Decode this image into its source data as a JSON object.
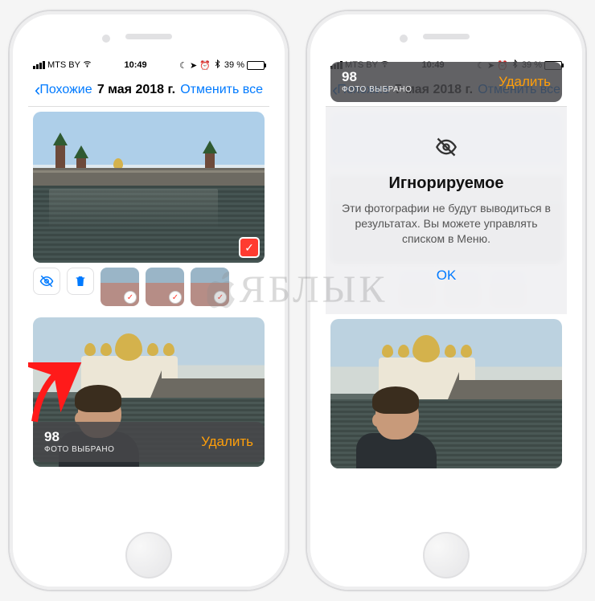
{
  "status": {
    "carrier": "MTS BY",
    "time": "10:49",
    "battery_pct": "39 %"
  },
  "nav": {
    "back_label": "Похожие",
    "title": "7 мая 2018 г.",
    "cancel_all": "Отменить все"
  },
  "bottom": {
    "count": "98",
    "label": "ФОТО ВЫБРАНО",
    "delete": "Удалить"
  },
  "alert": {
    "title": "Игнорируемое",
    "body": "Эти фотографии не будут выводиться в результатах. Вы можете управлять списком в Меню.",
    "ok": "OK"
  },
  "watermark": "ЯБЛЫК"
}
